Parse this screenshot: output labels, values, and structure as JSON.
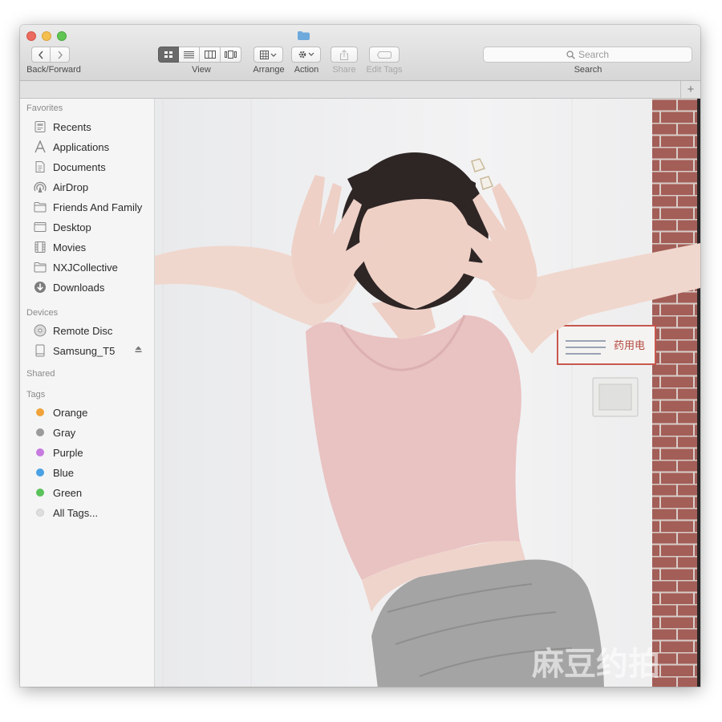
{
  "colors": {
    "close": "#ec6a5e",
    "minimize": "#f5bf4f",
    "zoom": "#61c554",
    "accent": "#6ea9dc"
  },
  "toolbar": {
    "back_forward_label": "Back/Forward",
    "view_label": "View",
    "arrange_label": "Arrange",
    "action_label": "Action",
    "share_label": "Share",
    "edit_tags_label": "Edit Tags",
    "search_label": "Search",
    "search_placeholder": "Search"
  },
  "sidebar": {
    "favorites_header": "Favorites",
    "favorites": [
      {
        "label": "Recents",
        "icon": "recents-icon"
      },
      {
        "label": "Applications",
        "icon": "applications-icon"
      },
      {
        "label": "Documents",
        "icon": "documents-icon"
      },
      {
        "label": "AirDrop",
        "icon": "airdrop-icon"
      },
      {
        "label": "Friends And Family",
        "icon": "folder-icon"
      },
      {
        "label": "Desktop",
        "icon": "desktop-icon"
      },
      {
        "label": "Movies",
        "icon": "movies-icon"
      },
      {
        "label": "NXJCollective",
        "icon": "folder-icon"
      },
      {
        "label": "Downloads",
        "icon": "downloads-icon"
      }
    ],
    "devices_header": "Devices",
    "devices": [
      {
        "label": "Remote Disc",
        "icon": "disc-icon"
      },
      {
        "label": "Samsung_T5",
        "icon": "drive-icon"
      }
    ],
    "shared_header": "Shared",
    "tags_header": "Tags",
    "tags": [
      {
        "label": "Orange",
        "color": "#f0a33a"
      },
      {
        "label": "Gray",
        "color": "#9b9b9b"
      },
      {
        "label": "Purple",
        "color": "#c77be0"
      },
      {
        "label": "Blue",
        "color": "#4aa1e4"
      },
      {
        "label": "Green",
        "color": "#5bc25b"
      },
      {
        "label": "All Tags...",
        "color": "#dedede"
      }
    ]
  },
  "content": {
    "photo": {
      "watermark": "麻豆约拍",
      "wall_sign": "药用电"
    }
  }
}
